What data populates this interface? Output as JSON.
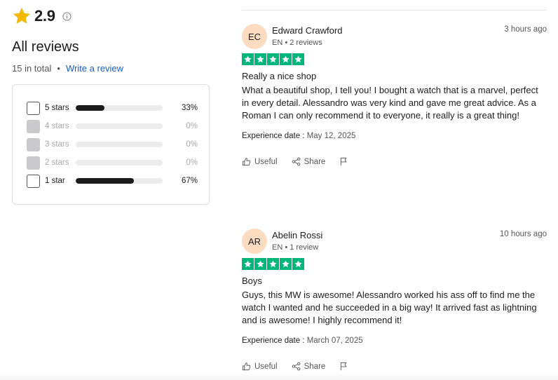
{
  "summary": {
    "score": "2.9",
    "title": "All reviews",
    "total": "15 in total",
    "separator": "•",
    "write_review": "Write a review"
  },
  "filters": [
    {
      "label": "5 stars",
      "percent": "33%",
      "fill": 0.33,
      "enabled": true
    },
    {
      "label": "4 stars",
      "percent": "0%",
      "fill": 0,
      "enabled": false
    },
    {
      "label": "3 stars",
      "percent": "0%",
      "fill": 0,
      "enabled": false
    },
    {
      "label": "2 stars",
      "percent": "0%",
      "fill": 0,
      "enabled": false
    },
    {
      "label": "1 star",
      "percent": "67%",
      "fill": 0.67,
      "enabled": true
    }
  ],
  "reviews": [
    {
      "initials": "EC",
      "name": "Edward Crawford",
      "meta": "EN • 2 reviews",
      "time": "3 hours ago",
      "stars": 5,
      "title": "Really a nice shop",
      "body": "What a beautiful shop, I tell you! I bought a watch that is a marvel, perfect in every detail. Alessandro was very kind and gave me great advice. As a Roman I can only recommend it to everyone, it really is a great thing!",
      "exp_label": "Experience date : ",
      "exp_date": "May 12, 2025",
      "useful": "Useful",
      "share": "Share"
    },
    {
      "initials": "AR",
      "name": "Abelin Rossi",
      "meta": "EN • 1 review",
      "time": "10 hours ago",
      "stars": 5,
      "title": "Boys",
      "body": "Guys, this MW is awesome! Alessandro worked his ass off to find me the watch I wanted and he succeeded in a big way! It arrived fast as lightning and is awesome! I highly recommend it!",
      "exp_label": "Experience date : ",
      "exp_date": "March 07, 2025",
      "useful": "Useful",
      "share": "Share"
    }
  ],
  "colors": {
    "star_gold": "#f5b800",
    "trust_green": "#00b67a",
    "link_blue": "#1a5cc2",
    "avatar_bg": "#fcdcc0"
  },
  "icons": [
    "star-icon",
    "info-icon",
    "thumbs-up-icon",
    "share-icon",
    "flag-icon"
  ]
}
